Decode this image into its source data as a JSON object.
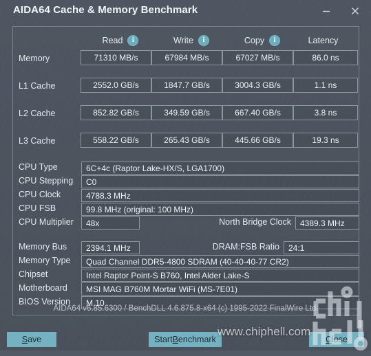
{
  "window": {
    "title": "AIDA64 Cache & Memory Benchmark",
    "minimize_icon": "minimize-icon",
    "close_icon": "close-icon"
  },
  "benchmark": {
    "columns": [
      {
        "label": "Read",
        "info_icon": "info-icon",
        "has_info": true
      },
      {
        "label": "Write",
        "info_icon": "info-icon",
        "has_info": true
      },
      {
        "label": "Copy",
        "info_icon": "info-icon",
        "has_info": true
      },
      {
        "label": "Latency",
        "info_icon": "",
        "has_info": false
      }
    ],
    "rows": [
      {
        "label": "Memory",
        "read": "71310 MB/s",
        "write": "67984 MB/s",
        "copy": "67027 MB/s",
        "latency": "86.0 ns"
      },
      {
        "label": "L1 Cache",
        "read": "2552.0 GB/s",
        "write": "1847.7 GB/s",
        "copy": "3004.3 GB/s",
        "latency": "1.1 ns"
      },
      {
        "label": "L2 Cache",
        "read": "852.82 GB/s",
        "write": "349.59 GB/s",
        "copy": "667.40 GB/s",
        "latency": "3.8 ns"
      },
      {
        "label": "L3 Cache",
        "read": "558.22 GB/s",
        "write": "265.43 GB/s",
        "copy": "445.66 GB/s",
        "latency": "19.3 ns"
      }
    ]
  },
  "cpu_info": {
    "type_label": "CPU Type",
    "type_value": "6C+4c   (Raptor Lake-HX/S, LGA1700)",
    "stepping_label": "CPU Stepping",
    "stepping_value": "C0",
    "clock_label": "CPU Clock",
    "clock_value": "4788.3 MHz",
    "fsb_label": "CPU FSB",
    "fsb_value": "99.8 MHz  (original: 100 MHz)",
    "multiplier_label": "CPU Multiplier",
    "multiplier_value": "48x",
    "north_bridge_label": "North Bridge Clock",
    "north_bridge_value": "4389.3 MHz"
  },
  "system_info": {
    "memory_bus_label": "Memory Bus",
    "memory_bus_value": "2394.1 MHz",
    "dram_fsb_label": "DRAM:FSB Ratio",
    "dram_fsb_value": "24:1",
    "memory_type_label": "Memory Type",
    "memory_type_value": "Quad Channel DDR5-4800 SDRAM  (40-40-40-77 CR2)",
    "chipset_label": "Chipset",
    "chipset_value": "Intel Raptor Point-S B760, Intel Alder Lake-S",
    "motherboard_label": "Motherboard",
    "motherboard_value": "MSI MAG B760M Mortar WiFi (MS-7E01)",
    "bios_label": "BIOS Version",
    "bios_value": "M.10"
  },
  "footer": {
    "version_text": "AIDA64 v6.85.6300 / BenchDLL 4.6.875.8-x64  (c) 1995-2022 FinalWire Ltd.",
    "save_button": "Save",
    "save_accel": "S",
    "save_rest": "ave",
    "start_button": "Start Benchmark",
    "start_pre": "Start ",
    "start_accel": "B",
    "start_rest": "enchmark",
    "close_button": "Close",
    "close_accel": "C",
    "close_rest": "lose"
  },
  "watermark": {
    "url": "www.chiphell.com",
    "logo": "chiphell-logo"
  },
  "colors": {
    "accent_teal": "#74b2c1",
    "info_icon": "#6bafbe",
    "window_bg": "#4a515c",
    "field_border": "#8d959f"
  }
}
